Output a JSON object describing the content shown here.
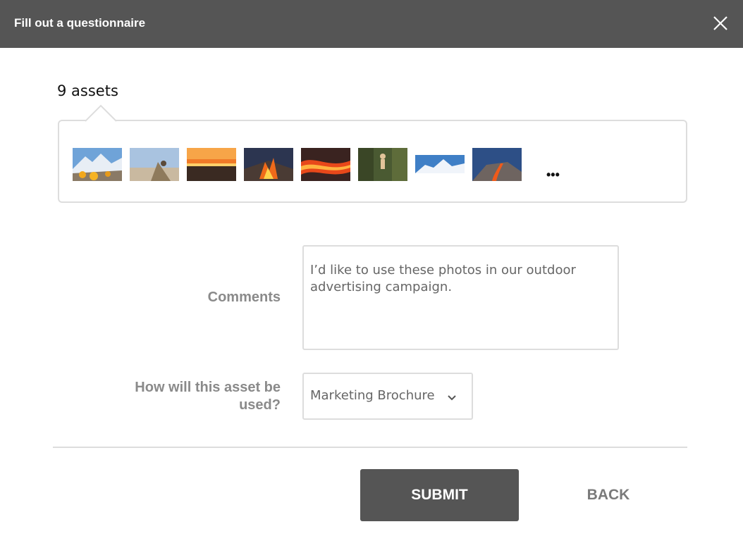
{
  "dialog": {
    "title": "Fill out a questionnaire"
  },
  "assets": {
    "count_label": "9 assets",
    "more_label": "•••",
    "thumbnails": [
      {
        "name": "mountain-camp-tents-thumbnail"
      },
      {
        "name": "hiker-on-ridge-thumbnail"
      },
      {
        "name": "orange-sunset-clouds-thumbnail"
      },
      {
        "name": "campfire-night-thumbnail"
      },
      {
        "name": "lava-flow-thumbnail"
      },
      {
        "name": "rock-climber-thumbnail"
      },
      {
        "name": "snowy-peak-panorama-thumbnail"
      },
      {
        "name": "volcano-eruption-thumbnail"
      }
    ]
  },
  "form": {
    "comments_label": "Comments",
    "comments_value": "I’d like to use these photos in our outdoor advertising campaign.",
    "usage_label": "How will this asset be used?",
    "usage_selected": "Marketing Brochure"
  },
  "actions": {
    "submit_label": "SUBMIT",
    "back_label": "BACK"
  },
  "colors": {
    "titlebar": "#555555",
    "submit": "#555555",
    "border": "#dddddd",
    "label": "#8a8a8a"
  }
}
